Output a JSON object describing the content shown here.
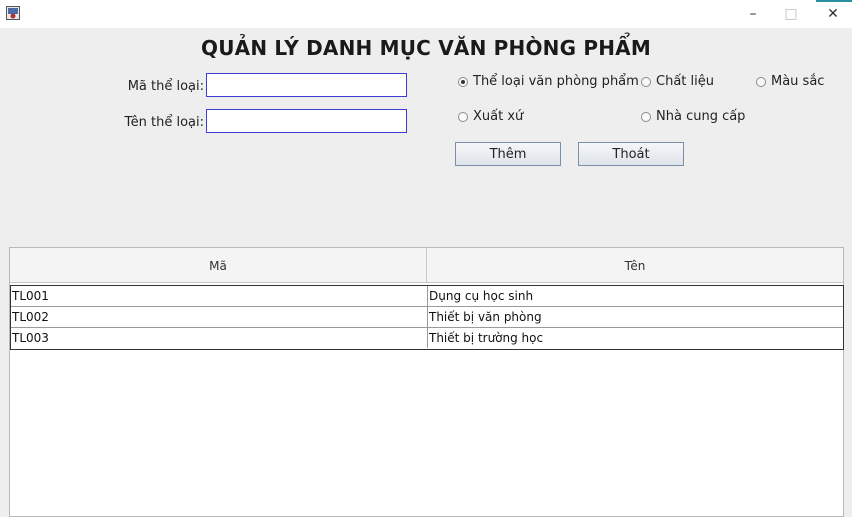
{
  "window": {
    "minimize_glyph": "–",
    "maximize_glyph": "□",
    "close_glyph": "✕"
  },
  "header": {
    "title": "QUẢN LÝ DANH MỤC VĂN PHÒNG PHẨM"
  },
  "form": {
    "code_label": "Mã thể loại:",
    "code_value": "",
    "name_label": "Tên thể loại:",
    "name_value": ""
  },
  "categories": {
    "options": [
      {
        "label": "Thể loại văn phòng phẩm",
        "selected": true
      },
      {
        "label": "Chất liệu",
        "selected": false
      },
      {
        "label": "Màu sắc",
        "selected": false
      },
      {
        "label": "Xuất xứ",
        "selected": false
      },
      {
        "label": "Nhà cung cấp",
        "selected": false
      }
    ]
  },
  "actions": {
    "add_label": "Thêm",
    "exit_label": "Thoát"
  },
  "table": {
    "columns": [
      "Mã",
      "Tên"
    ],
    "rows": [
      [
        "TL001",
        "Dụng cụ học sinh"
      ],
      [
        "TL002",
        "Thiết bị văn phòng"
      ],
      [
        "TL003",
        "Thiết bị trường học"
      ]
    ]
  }
}
